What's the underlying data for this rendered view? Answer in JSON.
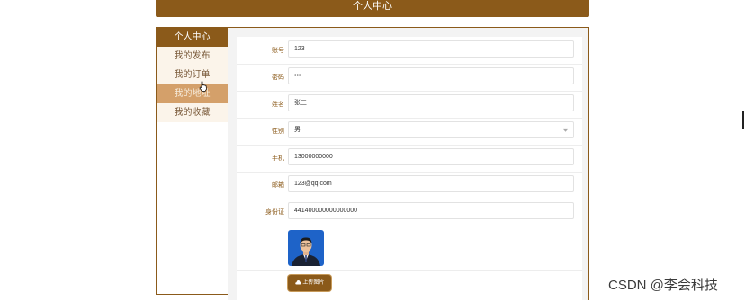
{
  "header": {
    "title": "个人中心"
  },
  "sidebar": {
    "title": "个人中心",
    "items": [
      {
        "label": "我的发布"
      },
      {
        "label": "我的订单"
      },
      {
        "label": "我的地址"
      },
      {
        "label": "我的收藏"
      }
    ]
  },
  "form": {
    "account": {
      "label": "账号",
      "value": "123"
    },
    "password": {
      "label": "密码",
      "value": "•••"
    },
    "name": {
      "label": "姓名",
      "value": "张三"
    },
    "gender": {
      "label": "性别",
      "value": "男"
    },
    "phone": {
      "label": "手机",
      "value": "13000000000"
    },
    "email": {
      "label": "邮箱",
      "value": "123@qq.com"
    },
    "id_card": {
      "label": "身份证",
      "value": "441400000000000000"
    },
    "upload_label": "上传图片"
  },
  "watermark": "CSDN @李会科技",
  "colors": {
    "brand": "#8b5a1a",
    "active_item": "#d4a06a",
    "item_bg": "#fbf4ea"
  }
}
